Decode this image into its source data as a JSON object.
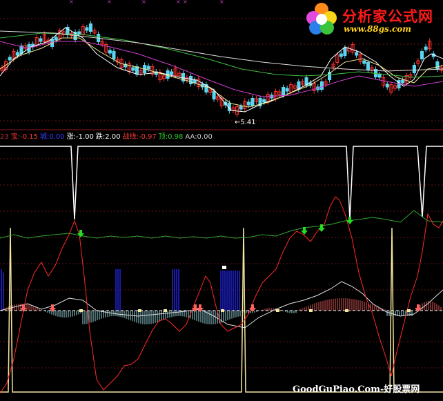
{
  "indicator_bar": {
    "items": [
      {
        "label": "23",
        "color": "#b03030"
      },
      {
        "label": "宝:-0.15",
        "color": "#ff3a3a"
      },
      {
        "label": "城:0.00",
        "color": "#3a3aff"
      },
      {
        "label": "涨:-1.00",
        "color": "#ffffff"
      },
      {
        "label": "跌:2.00",
        "color": "#ffffff"
      },
      {
        "label": "战线:-0.97",
        "color": "#ff3a3a"
      },
      {
        "label": "顶:0.98",
        "color": "#2ecc2e"
      },
      {
        "label": "AA:0.00",
        "color": "#cccccc"
      }
    ]
  },
  "price_chart": {
    "low_price_label": "←5.41"
  },
  "logo": {
    "title": "分析家公式网",
    "url": "www.88gs.com"
  },
  "watermark": "GoodGuPiao.Com-好股票网",
  "colors": {
    "background": "#000000",
    "candle_up": "#ff3030",
    "candle_down": "#5ad6f0",
    "ma_white": "#ffffff",
    "ma_yellow": "#f0e68c",
    "ma_magenta": "#d040d0",
    "ma_green": "#40c040",
    "osc_red": "#ff2a2a",
    "osc_green": "#2fa82f",
    "spike_white": "#ffffff",
    "spike_yellow": "#f5e6a0",
    "blue_bars": "#1a1aa8",
    "grid_red": "#6a1414"
  }
}
